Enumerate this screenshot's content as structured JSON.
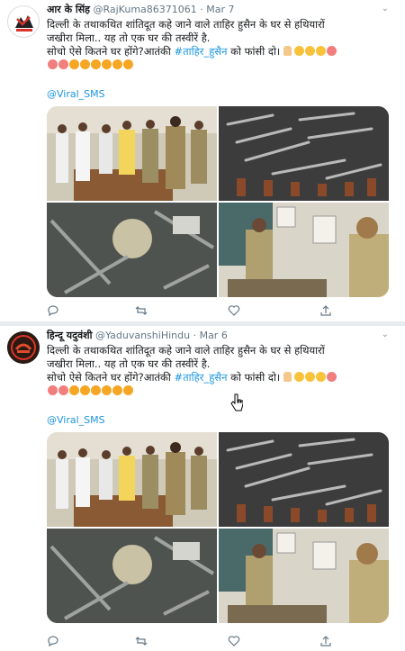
{
  "tweets": [
    {
      "name": "आर के सिंह",
      "handle": "@RajKuma86371061",
      "date": "Mar 7",
      "line1": "दिल्ली के तथाकथित शांतिदूत कहे जाने वाले ताहिर हुसैन के घर से हथियारों",
      "line2": "जखीरा मिला..  यह तो एक घर की तस्वीरें है.",
      "line3_pre": "सोचो ऐसे कितने घर होंगे?आतंकी ",
      "hashtag": "#ताहिर_हुसैन",
      "line3_post": " को फांसी दो।",
      "mention": "@Viral_SMS"
    },
    {
      "name": "हिन्दू यदुवंशी",
      "handle": "@YaduvanshiHindu",
      "date": "Mar 6",
      "line1": "दिल्ली के तथाकथित शांतिदूत कहे जाने वाले ताहिर हुसैन के घर से हथियारों",
      "line2": "जखीरा मिला..  यह तो एक घर की तस्वीरें है.",
      "line3_pre": "सोचो ऐसे कितने घर होंगे?आतंकी ",
      "hashtag": "#ताहिर_हुसैन",
      "line3_post": " को फांसी दो।",
      "mention": "@Viral_SMS"
    }
  ],
  "ui": {
    "dot": "·",
    "chevron": "⌄",
    "reply_icon": "reply-icon",
    "retweet_icon": "retweet-icon",
    "like_icon": "like-icon",
    "share_icon": "share-icon"
  }
}
